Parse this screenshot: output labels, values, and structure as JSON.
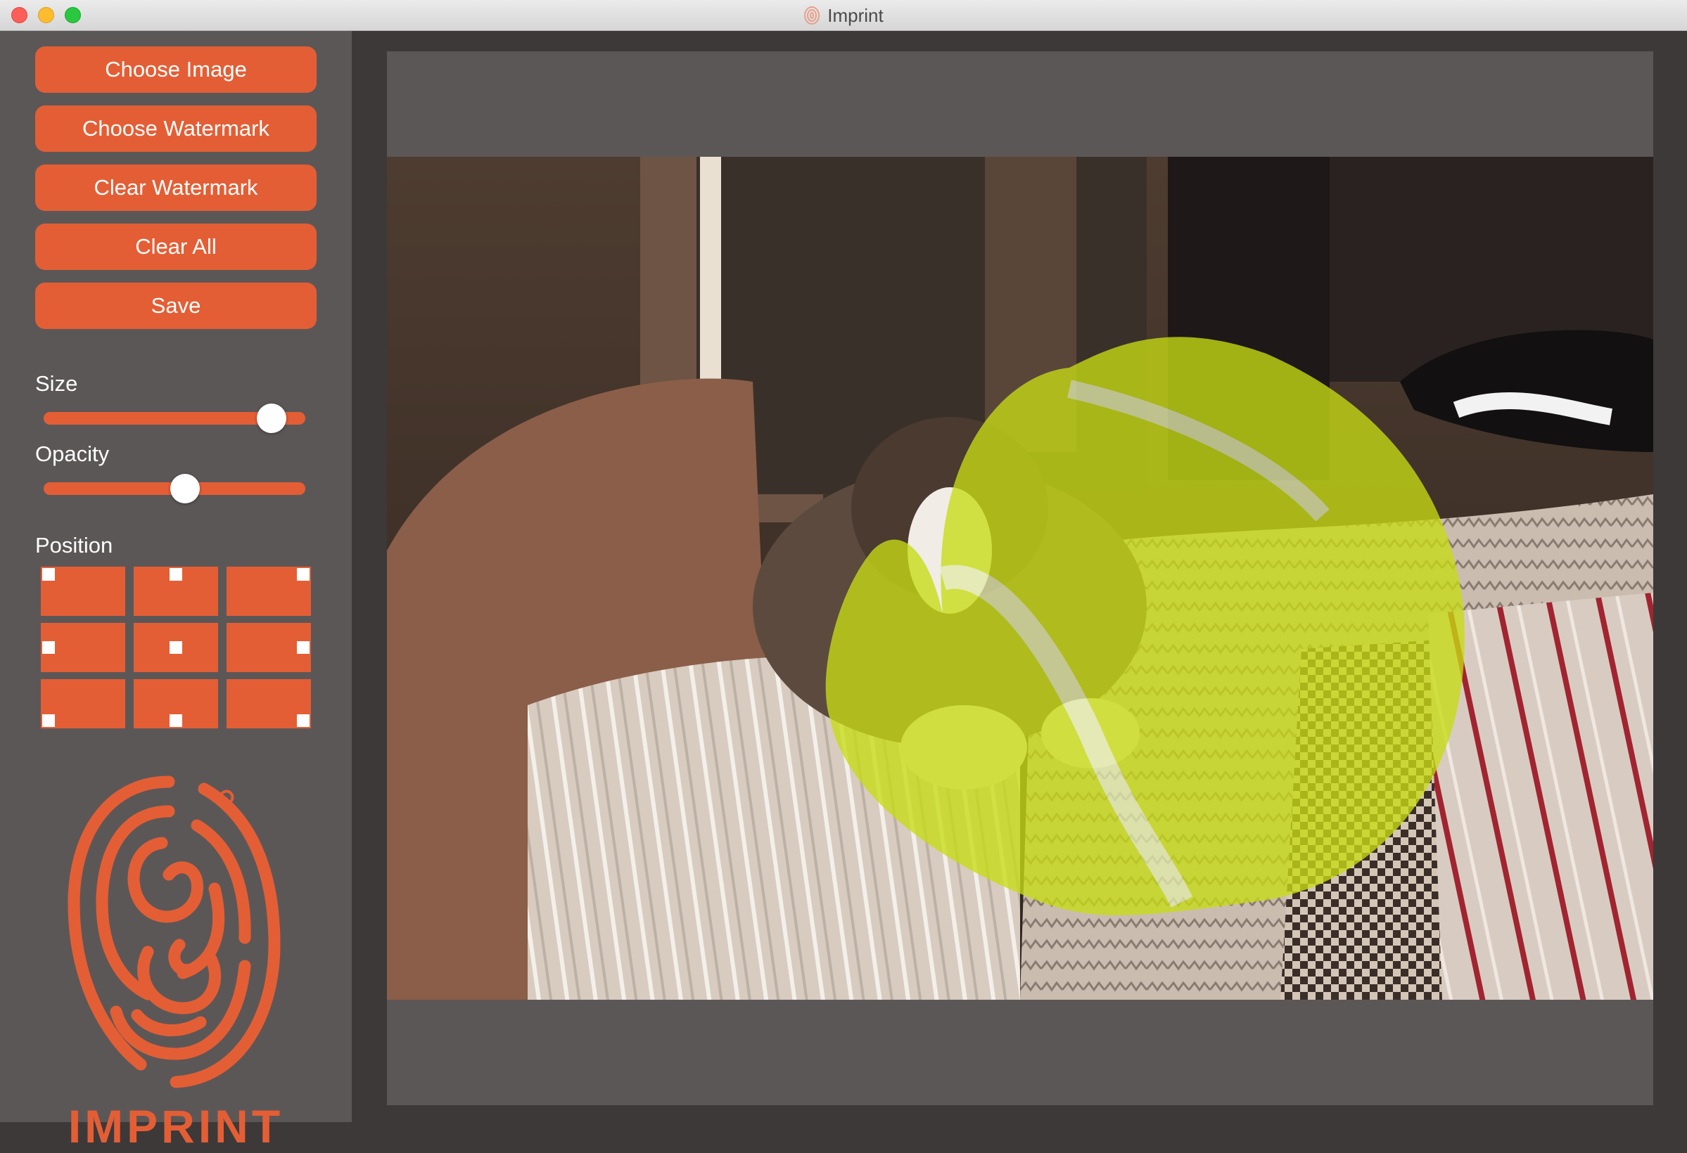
{
  "window": {
    "title": "Imprint",
    "app_icon": "fingerprint-icon"
  },
  "sidebar": {
    "buttons": [
      {
        "id": "choose-image",
        "label": "Choose Image"
      },
      {
        "id": "choose-watermark",
        "label": "Choose Watermark"
      },
      {
        "id": "clear-watermark",
        "label": "Clear Watermark"
      },
      {
        "id": "clear-all",
        "label": "Clear All"
      },
      {
        "id": "save",
        "label": "Save"
      }
    ],
    "size": {
      "label": "Size",
      "value": 0.87
    },
    "opacity": {
      "label": "Opacity",
      "value": 0.54
    },
    "position": {
      "label": "Position",
      "options": [
        "top-left",
        "top-center",
        "top-right",
        "middle-left",
        "center",
        "middle-right",
        "bottom-left",
        "bottom-center",
        "bottom-right"
      ]
    },
    "logo": {
      "text": "IMPRINT",
      "icon": "fingerprint-logo-icon"
    }
  },
  "colors": {
    "accent": "#e45e35",
    "sidebar_bg": "#5c5757",
    "window_bg": "#3d3939",
    "watermark": "#c8dc14"
  },
  "canvas": {
    "photo": "dog lying on striped bed",
    "watermark": "tennis-ball-icon"
  }
}
